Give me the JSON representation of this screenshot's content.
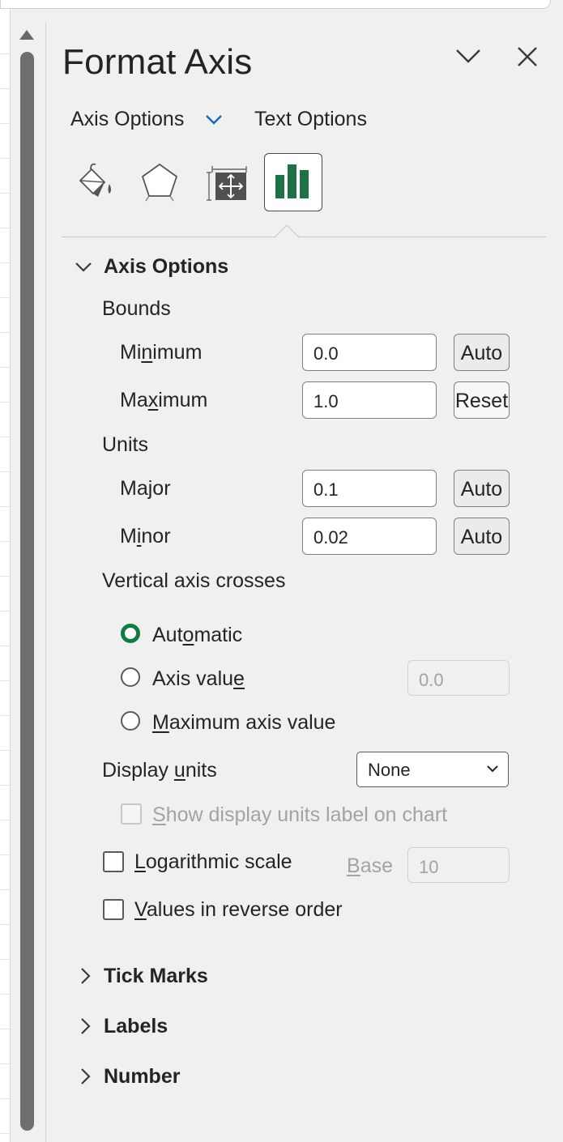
{
  "panel": {
    "title": "Format Axis",
    "header_icons": [
      "chevron-down-icon",
      "close-icon"
    ]
  },
  "tabs": {
    "axis_options": "Axis Options",
    "text_options": "Text Options"
  },
  "category_icons": [
    "fill-line-icon",
    "effects-icon",
    "size-properties-icon",
    "axis-options-icon"
  ],
  "section": {
    "title": "Axis Options",
    "bounds_heading": "Bounds",
    "minimum": {
      "label_pre": "Mi",
      "label_u": "n",
      "label_post": "imum",
      "value": "0.0",
      "button": "Auto"
    },
    "maximum": {
      "label_pre": "Ma",
      "label_u": "x",
      "label_post": "imum",
      "value": "1.0",
      "button": "Reset"
    },
    "units_heading": "Units",
    "major": {
      "label_pre": "Ma",
      "label_u": "j",
      "label_post": "or",
      "value": "0.1",
      "button": "Auto"
    },
    "minor": {
      "label_pre": "M",
      "label_u": "i",
      "label_post": "nor",
      "value": "0.02",
      "button": "Auto"
    },
    "crosses_heading": "Vertical axis crosses",
    "radio_automatic": {
      "pre": "Aut",
      "u": "o",
      "post": "matic"
    },
    "radio_axis_value": {
      "pre": "Axis valu",
      "u": "e",
      "post": "",
      "value": "0.0"
    },
    "radio_max": {
      "pre": "",
      "u": "M",
      "post": "aximum axis value"
    },
    "display_units": {
      "pre": "Display ",
      "u": "u",
      "post": "nits",
      "selected": "None"
    },
    "show_label": {
      "pre": "",
      "u": "S",
      "post": "how display units label on chart"
    },
    "log_scale": {
      "pre": "",
      "u": "L",
      "post": "ogarithmic scale"
    },
    "base": {
      "pre": "",
      "u": "B",
      "post": "ase",
      "value": "10"
    },
    "reverse": {
      "pre": "",
      "u": "V",
      "post": "alues in reverse order"
    }
  },
  "collapsed_sections": [
    "Tick Marks",
    "Labels",
    "Number"
  ],
  "colors": {
    "accent_green": "#107c41",
    "accent_blue": "#0f6cbd",
    "panel_bg": "#f0f0f0"
  }
}
